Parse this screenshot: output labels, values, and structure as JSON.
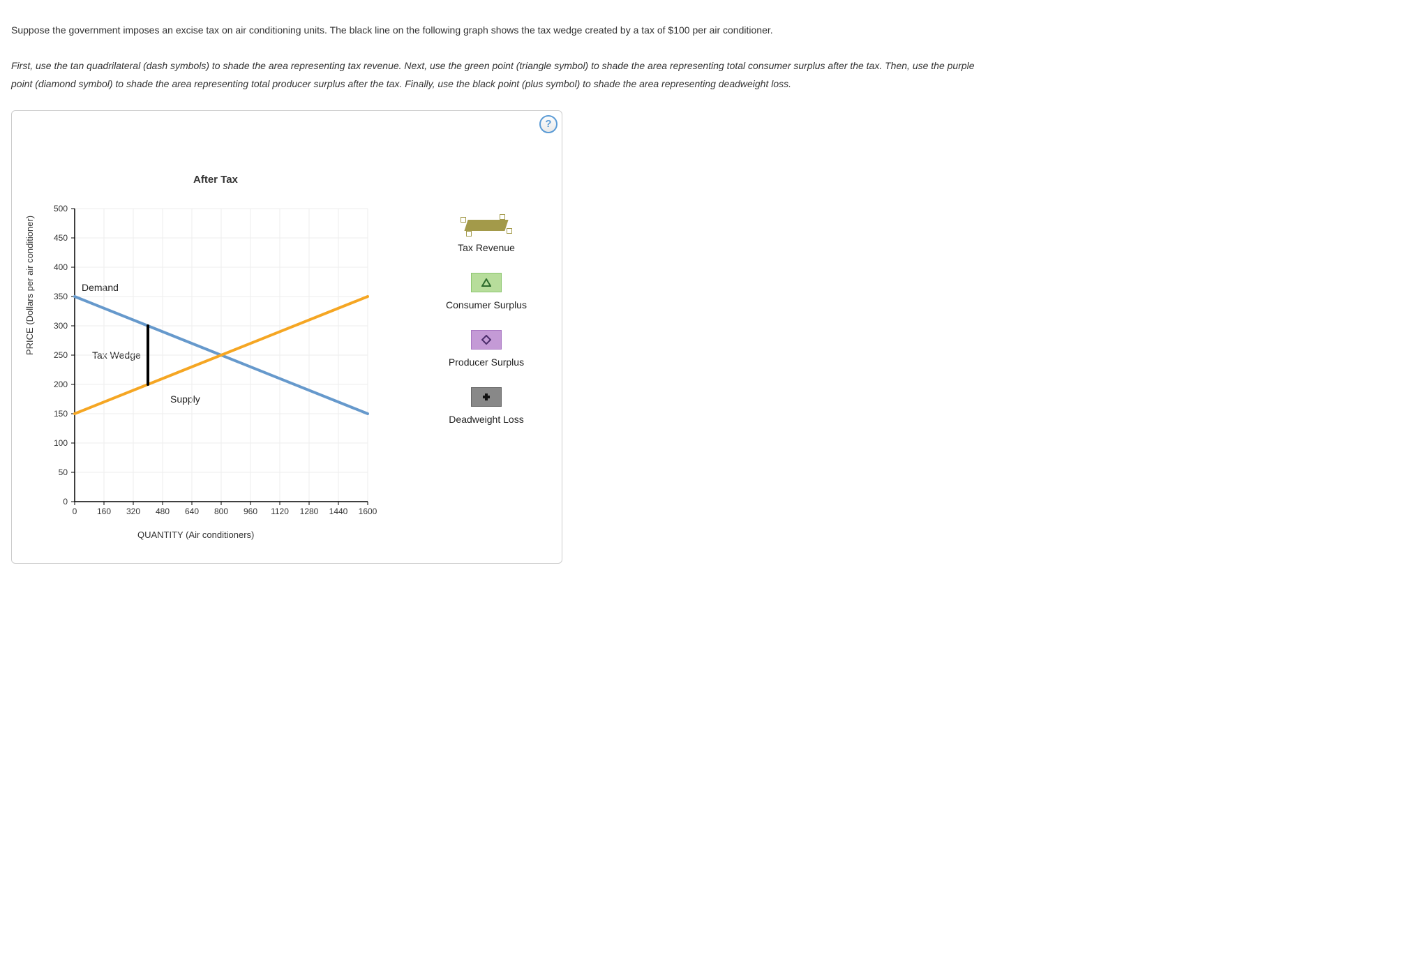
{
  "paragraph1_a": "Suppose the government imposes an excise tax on air conditioning units. The black line on the following graph shows the tax wedge created by a tax of $100 per air conditioner.",
  "paragraph2_a": "First, use the tan quadrilateral (dash symbols) to shade the area representing tax revenue. Next, use the green point (triangle symbol) to shade the area representing total consumer surplus after the tax. Then, use the purple point (diamond symbol) to shade the area representing total producer surplus after the tax. Finally, use the black point (plus symbol) to shade the area representing deadweight loss.",
  "help_symbol": "?",
  "chart_title": "After Tax",
  "y_axis_label": "PRICE (Dollars per air conditioner)",
  "x_axis_label": "QUANTITY (Air conditioners)",
  "demand_label": "Demand",
  "supply_label": "Supply",
  "wedge_label": "Tax Wedge",
  "legend": {
    "tax_revenue": "Tax Revenue",
    "consumer_surplus": "Consumer Surplus",
    "producer_surplus": "Producer Surplus",
    "deadweight_loss": "Deadweight Loss"
  },
  "chart_data": {
    "type": "line",
    "title": "After Tax",
    "xlabel": "QUANTITY (Air conditioners)",
    "ylabel": "PRICE (Dollars per air conditioner)",
    "xlim": [
      0,
      1600
    ],
    "ylim": [
      0,
      500
    ],
    "x_ticks": [
      0,
      160,
      320,
      480,
      640,
      800,
      960,
      1120,
      1280,
      1440,
      1600
    ],
    "y_ticks": [
      0,
      50,
      100,
      150,
      200,
      250,
      300,
      350,
      400,
      450,
      500
    ],
    "series": [
      {
        "name": "Demand",
        "color": "#6699cc",
        "points": [
          [
            0,
            350
          ],
          [
            1600,
            150
          ]
        ]
      },
      {
        "name": "Supply",
        "color": "#f5a623",
        "points": [
          [
            0,
            150
          ],
          [
            1600,
            350
          ]
        ]
      },
      {
        "name": "Tax Wedge",
        "color": "#000000",
        "points": [
          [
            400,
            300
          ],
          [
            400,
            200
          ]
        ]
      }
    ],
    "annotations": [
      {
        "text": "Demand",
        "x": 80,
        "y": 360
      },
      {
        "text": "Supply",
        "x": 520,
        "y": 210
      },
      {
        "text": "Tax Wedge",
        "x": 200,
        "y": 255
      }
    ]
  }
}
